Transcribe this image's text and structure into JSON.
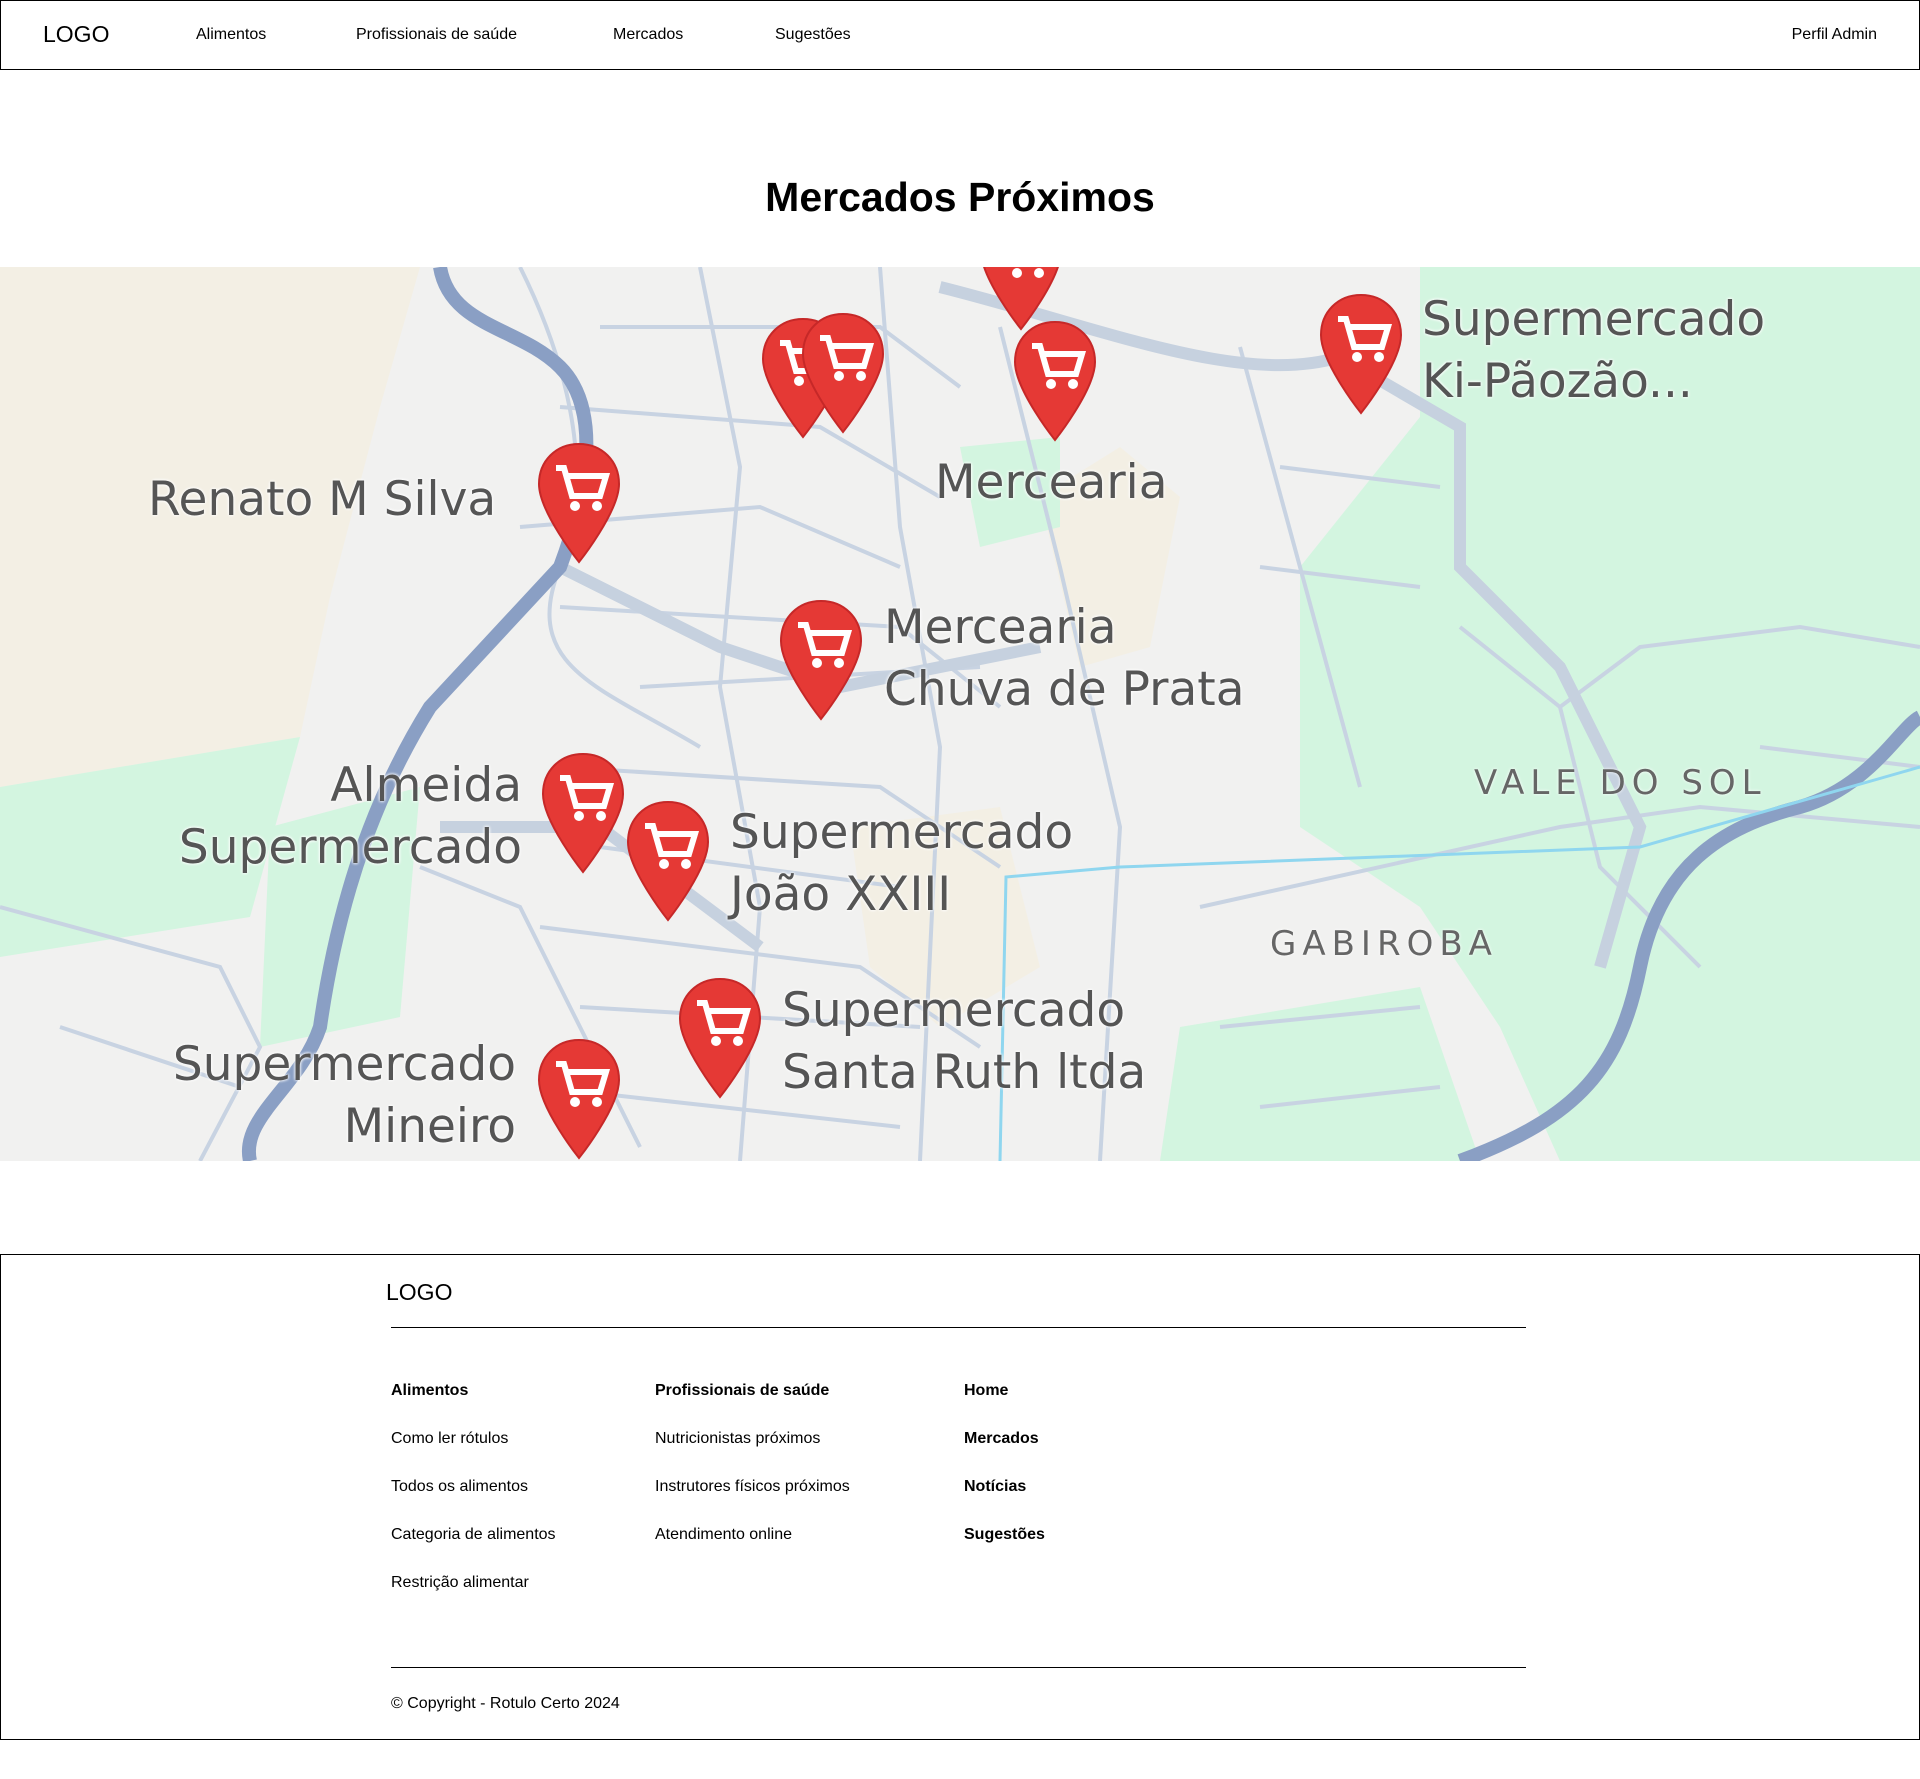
{
  "header": {
    "logo": "LOGO",
    "nav": [
      "Alimentos",
      "Profissionais de saúde",
      "Mercados",
      "Sugestões"
    ],
    "profile": "Perfil Admin"
  },
  "page": {
    "title": "Mercados Próximos"
  },
  "map": {
    "marker_icon": "shopping-cart-pin-icon",
    "marker_color": "#e53935",
    "markers": [
      {
        "name": "Supermercado\nKi-Pãozão..."
      },
      {
        "name": "Mercearia"
      },
      {
        "name": "Renato M Silva"
      },
      {
        "name": "Mercearia\nChuva de Prata"
      },
      {
        "name": "Almeida\nSupermercado"
      },
      {
        "name": "Supermercado\nJoão XXIII"
      },
      {
        "name": "Supermercado\nSanta Ruth ltda"
      },
      {
        "name": "Supermercado\nMineiro"
      }
    ],
    "areas": [
      "VALE DO SOL",
      "GABIROBA"
    ],
    "colors": {
      "park": "#d3f5e0",
      "road": "#c8d3e2",
      "highway": "#8a9fc4",
      "sand": "#f3efe4"
    }
  },
  "footer": {
    "logo": "LOGO",
    "columns": [
      {
        "heading": "Alimentos",
        "links": [
          "Como ler rótulos",
          "Todos os alimentos",
          "Categoria de alimentos",
          "Restrição alimentar"
        ]
      },
      {
        "heading": "Profissionais de saúde",
        "links": [
          "Nutricionistas próximos",
          "Instrutores físicos próximos",
          "Atendimento online"
        ]
      },
      {
        "heading": "Home",
        "links": [
          "Mercados",
          "Notícias",
          "Sugestões"
        ]
      }
    ],
    "copyright": "© Copyright - Rotulo Certo 2024"
  }
}
